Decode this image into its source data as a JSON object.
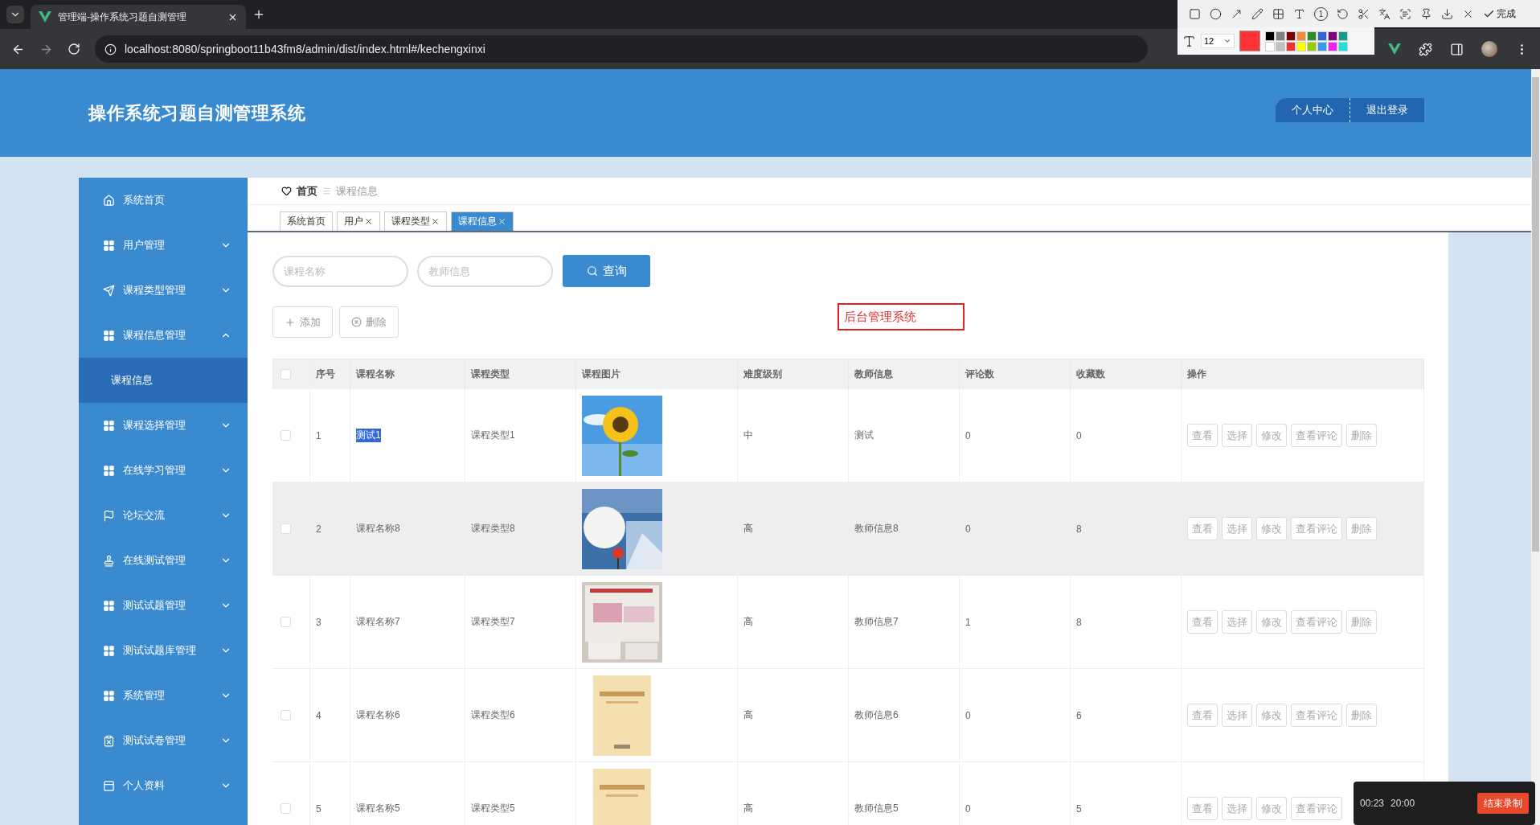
{
  "browser": {
    "tab_title": "管理端-操作系统习题自测管理",
    "url": "localhost:8080/springboot11b43fm8/admin/dist/index.html#/kechengxinxi"
  },
  "annotation_toolbar": {
    "step_number": "1",
    "done": "完成",
    "font_size": "12",
    "palette": [
      {
        "color": "#000000"
      },
      {
        "color": "#808080"
      },
      {
        "color": "#800000"
      },
      {
        "color": "#f08a3c"
      },
      {
        "color": "#2e8b2e"
      },
      {
        "color": "#3366cc"
      },
      {
        "color": "#800080"
      },
      {
        "color": "#169a8c"
      },
      {
        "color": "#ffffff"
      },
      {
        "color": "#c0c0c0"
      },
      {
        "color": "#ee3333"
      },
      {
        "color": "#ffff00"
      },
      {
        "color": "#99cc00"
      },
      {
        "color": "#3399ee"
      },
      {
        "color": "#ee22ee"
      },
      {
        "color": "#22dddd"
      }
    ]
  },
  "header": {
    "title": "操作系统习题自测管理系统",
    "buttons": [
      "个人中心",
      "退出登录"
    ]
  },
  "sidebar": {
    "items": [
      {
        "label": "系统首页",
        "kind": "link"
      },
      {
        "label": "用户管理",
        "kind": "menu",
        "expanded": false
      },
      {
        "label": "课程类型管理",
        "kind": "menu",
        "expanded": false
      },
      {
        "label": "课程信息管理",
        "kind": "menu",
        "expanded": true,
        "children": [
          {
            "label": "课程信息",
            "selected": true
          }
        ]
      },
      {
        "label": "课程选择管理",
        "kind": "menu",
        "expanded": false
      },
      {
        "label": "在线学习管理",
        "kind": "menu",
        "expanded": false
      },
      {
        "label": "论坛交流",
        "kind": "menu",
        "expanded": false
      },
      {
        "label": "在线测试管理",
        "kind": "menu",
        "expanded": false
      },
      {
        "label": "测试试题管理",
        "kind": "menu",
        "expanded": false
      },
      {
        "label": "测试试题库管理",
        "kind": "menu",
        "expanded": false
      },
      {
        "label": "系统管理",
        "kind": "menu",
        "expanded": false
      },
      {
        "label": "测试试卷管理",
        "kind": "menu",
        "expanded": false
      },
      {
        "label": "个人资料",
        "kind": "menu",
        "expanded": false
      }
    ]
  },
  "breadcrumb": {
    "home": "首页",
    "current": "课程信息"
  },
  "tabs": [
    {
      "label": "系统首页",
      "closable": false,
      "selected": false
    },
    {
      "label": "用户",
      "closable": true,
      "selected": false
    },
    {
      "label": "课程类型",
      "closable": true,
      "selected": false
    },
    {
      "label": "课程信息",
      "closable": true,
      "selected": true
    }
  ],
  "search": {
    "fields": [
      {
        "placeholder": "课程名称"
      },
      {
        "placeholder": "教师信息"
      }
    ],
    "button": "查询"
  },
  "toolbar": {
    "add": "添加",
    "delete": "删除"
  },
  "annotation_text": "后台管理系统",
  "table": {
    "columns": [
      "序号",
      "课程名称",
      "课程类型",
      "课程图片",
      "难度级别",
      "教师信息",
      "评论数",
      "收藏数",
      "操作"
    ],
    "header_checked": false,
    "rows": [
      {
        "checked": false,
        "hovered": false,
        "index": "1",
        "name": "测试1",
        "name_highlighted": true,
        "type": "课程类型1",
        "picture": {
          "kind": "picture"
        },
        "difficulty": "中",
        "teacher": "测试",
        "comments": "0",
        "favorites": "0",
        "actions": [
          "查看",
          "选择",
          "修改",
          "查看评论",
          "删除"
        ]
      },
      {
        "checked": false,
        "hovered": true,
        "index": "2",
        "name": "课程名称8",
        "name_highlighted": false,
        "type": "课程类型8",
        "picture": {
          "kind": "picture"
        },
        "difficulty": "高",
        "teacher": "教师信息8",
        "comments": "0",
        "favorites": "8",
        "actions": [
          "查看",
          "选择",
          "修改",
          "查看评论",
          "删除"
        ]
      },
      {
        "checked": false,
        "hovered": false,
        "index": "3",
        "name": "课程名称7",
        "name_highlighted": false,
        "type": "课程类型7",
        "picture": {
          "kind": "picture"
        },
        "difficulty": "高",
        "teacher": "教师信息7",
        "comments": "1",
        "favorites": "8",
        "actions": [
          "查看",
          "选择",
          "修改",
          "查看评论",
          "删除"
        ]
      },
      {
        "checked": false,
        "hovered": false,
        "index": "4",
        "name": "课程名称6",
        "name_highlighted": false,
        "type": "课程类型6",
        "picture": {
          "kind": "picture"
        },
        "difficulty": "高",
        "teacher": "教师信息6",
        "comments": "0",
        "favorites": "6",
        "actions": [
          "查看",
          "选择",
          "修改",
          "查看评论",
          "删除"
        ]
      },
      {
        "checked": false,
        "hovered": false,
        "index": "5",
        "name": "课程名称5",
        "name_highlighted": false,
        "type": "课程类型5",
        "picture": {
          "kind": "picture"
        },
        "difficulty": "高",
        "teacher": "教师信息5",
        "comments": "0",
        "favorites": "5",
        "actions": [
          "查看",
          "选择",
          "修改",
          "查看评论"
        ]
      }
    ]
  },
  "recorder": {
    "elapsed": "00:23",
    "limit": "20:00",
    "stop": "结束录制"
  }
}
